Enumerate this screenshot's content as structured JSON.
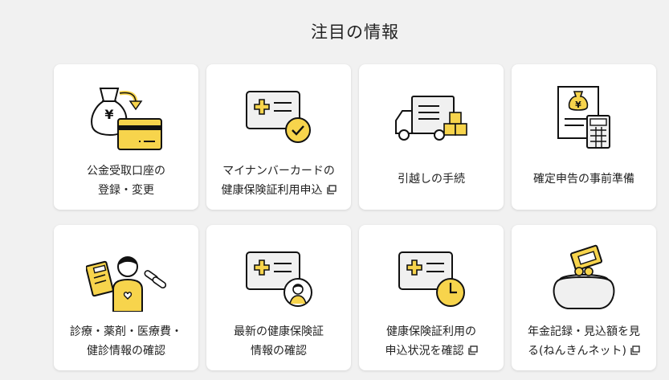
{
  "section_title": "注目の情報",
  "colors": {
    "accent": "#f7d44c",
    "outline": "#111111",
    "card_bg": "#ffffff",
    "page_bg": "#f1f1f1"
  },
  "cards": [
    {
      "icon": "money-bag-card-icon",
      "line1": "公金受取口座の",
      "line2": "登録・変更",
      "external": false
    },
    {
      "icon": "insurance-card-check-icon",
      "line1": "マイナンバーカードの",
      "line2": "健康保険証利用申込",
      "external": true
    },
    {
      "icon": "moving-truck-icon",
      "line1": "引越しの手続",
      "line2": "",
      "external": false
    },
    {
      "icon": "tax-document-calculator-icon",
      "line1": "確定申告の事前準備",
      "line2": "",
      "external": false
    },
    {
      "icon": "patient-medicine-icon",
      "line1": "診療・薬剤・医療費・",
      "line2": "健診情報の確認",
      "external": false
    },
    {
      "icon": "insurance-card-person-icon",
      "line1": "最新の健康保険証",
      "line2": "情報の確認",
      "external": false
    },
    {
      "icon": "insurance-card-clock-icon",
      "line1": "健康保険証利用の",
      "line2": "申込状況を確認",
      "external": true
    },
    {
      "icon": "coin-purse-icon",
      "line1": "年金記録・見込額を見",
      "line2": "る(ねんきんネット)",
      "external": true
    }
  ]
}
